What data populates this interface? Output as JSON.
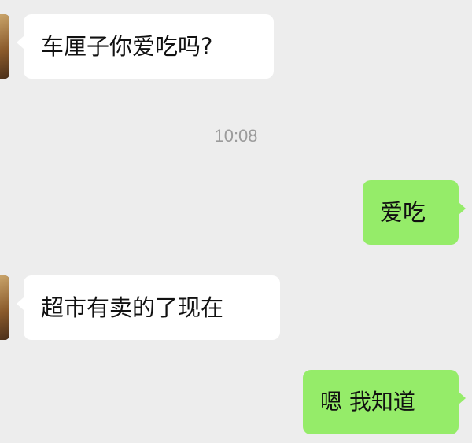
{
  "chat": {
    "messages": [
      {
        "side": "left",
        "text": "车厘子你爱吃吗?"
      },
      {
        "side": "right",
        "text": "爱吃"
      },
      {
        "side": "left",
        "text": "超市有卖的了现在"
      },
      {
        "side": "right",
        "text": "嗯 我知道"
      }
    ],
    "timestamp": "10:08"
  },
  "colors": {
    "background": "#ededed",
    "incoming_bubble": "#ffffff",
    "outgoing_bubble": "#95ec69",
    "timestamp_text": "#9b9b9b"
  }
}
